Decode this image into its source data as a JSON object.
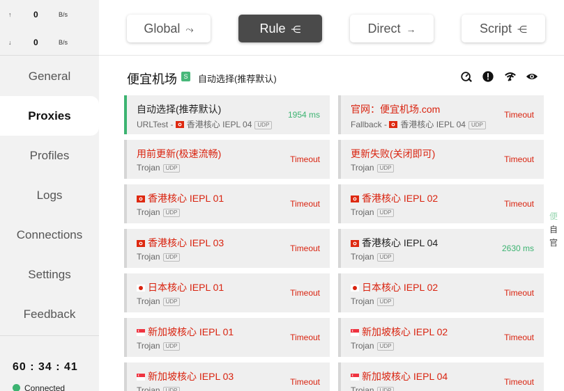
{
  "traffic": {
    "up_arrow": "↑",
    "up_value": "0",
    "up_unit": "B/s",
    "down_arrow": "↓",
    "down_value": "0",
    "down_unit": "B/s"
  },
  "nav": {
    "general": "General",
    "proxies": "Proxies",
    "profiles": "Profiles",
    "logs": "Logs",
    "connections": "Connections",
    "settings": "Settings",
    "feedback": "Feedback"
  },
  "status": {
    "uptime": "60 : 34 : 41",
    "connection": "Connected"
  },
  "modes": {
    "global": "Global",
    "rule": "Rule",
    "direct": "Direct",
    "script": "Script"
  },
  "group": {
    "title": "便宜机场",
    "badge": "S",
    "current": "自动选择(推荐默认)"
  },
  "header_icons": [
    "speed-test-icon",
    "alert-icon",
    "wifi-icon",
    "eye-icon"
  ],
  "proxies": [
    {
      "name": "自动选择(推荐默认)",
      "type": "URLTest",
      "detail": "香港核心 IEPL 04",
      "flag": "hk",
      "udp": "UDP",
      "latency": "1954 ms",
      "latency_ok": true,
      "name_err": false,
      "selected": true
    },
    {
      "name": "官网：便宜机场.com",
      "type": "Fallback",
      "detail": "香港核心 IEPL 04",
      "flag": "hk",
      "udp": "UDP",
      "latency": "Timeout",
      "latency_ok": false,
      "name_err": true,
      "selected": false
    },
    {
      "name": "用前更新(极速流畅)",
      "type": "Trojan",
      "detail": "",
      "flag": "",
      "udp": "UDP",
      "latency": "Timeout",
      "latency_ok": false,
      "name_err": true,
      "selected": false
    },
    {
      "name": "更新失败(关闭即可)",
      "type": "Trojan",
      "detail": "",
      "flag": "",
      "udp": "UDP",
      "latency": "Timeout",
      "latency_ok": false,
      "name_err": true,
      "selected": false
    },
    {
      "name": "香港核心 IEPL 01",
      "type": "Trojan",
      "detail": "",
      "flag": "hk",
      "udp": "UDP",
      "latency": "Timeout",
      "latency_ok": false,
      "name_err": true,
      "selected": false
    },
    {
      "name": "香港核心 IEPL 02",
      "type": "Trojan",
      "detail": "",
      "flag": "hk",
      "udp": "UDP",
      "latency": "Timeout",
      "latency_ok": false,
      "name_err": true,
      "selected": false
    },
    {
      "name": "香港核心 IEPL 03",
      "type": "Trojan",
      "detail": "",
      "flag": "hk",
      "udp": "UDP",
      "latency": "Timeout",
      "latency_ok": false,
      "name_err": true,
      "selected": false
    },
    {
      "name": "香港核心 IEPL 04",
      "type": "Trojan",
      "detail": "",
      "flag": "hk",
      "udp": "UDP",
      "latency": "2630 ms",
      "latency_ok": true,
      "name_err": false,
      "selected": false
    },
    {
      "name": "日本核心 IEPL 01",
      "type": "Trojan",
      "detail": "",
      "flag": "jp",
      "udp": "UDP",
      "latency": "Timeout",
      "latency_ok": false,
      "name_err": true,
      "selected": false
    },
    {
      "name": "日本核心 IEPL 02",
      "type": "Trojan",
      "detail": "",
      "flag": "jp",
      "udp": "UDP",
      "latency": "Timeout",
      "latency_ok": false,
      "name_err": true,
      "selected": false
    },
    {
      "name": "新加坡核心 IEPL 01",
      "type": "Trojan",
      "detail": "",
      "flag": "sg",
      "udp": "UDP",
      "latency": "Timeout",
      "latency_ok": false,
      "name_err": true,
      "selected": false
    },
    {
      "name": "新加坡核心 IEPL 02",
      "type": "Trojan",
      "detail": "",
      "flag": "sg",
      "udp": "UDP",
      "latency": "Timeout",
      "latency_ok": false,
      "name_err": true,
      "selected": false
    },
    {
      "name": "新加坡核心 IEPL 03",
      "type": "Trojan",
      "detail": "",
      "flag": "sg",
      "udp": "UDP",
      "latency": "Timeout",
      "latency_ok": false,
      "name_err": true,
      "selected": false
    },
    {
      "name": "新加坡核心 IEPL 04",
      "type": "Trojan",
      "detail": "",
      "flag": "sg",
      "udp": "UDP",
      "latency": "Timeout",
      "latency_ok": false,
      "name_err": true,
      "selected": false
    }
  ],
  "side_index": [
    "便",
    "自",
    "官"
  ],
  "colors": {
    "ok": "#3cb371",
    "error": "#d9230f",
    "active_mode": "#4a4a4a"
  }
}
